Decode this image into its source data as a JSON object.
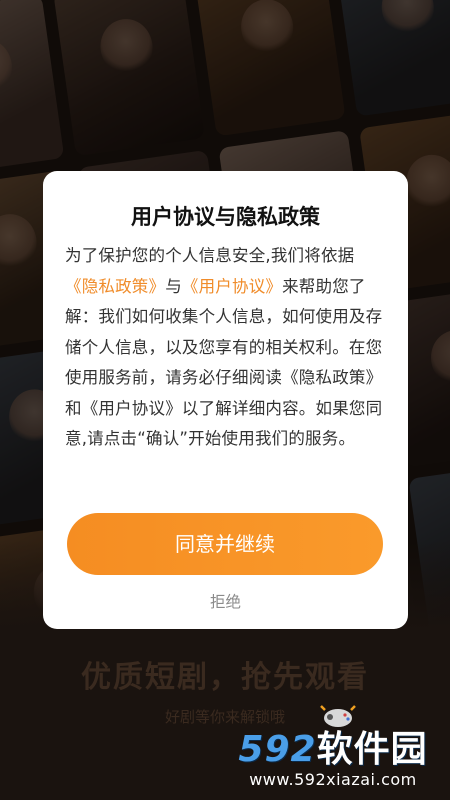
{
  "dialog": {
    "title": "用户协议与隐私政策",
    "body_line1": "为了保护您的个人信息安全,我们将依据",
    "privacy_link": "《隐私政策》",
    "connector": "与",
    "user_agreement_link": "《用户协议》",
    "body_after_links": "来帮助您了解：我们如何收集个人信息，如何使用及存储个人信息，以及您享有的相关权利。在您使用服务前，请务必仔细阅读《隐私政策》和《用户协议》以了解详细内容。如果您同意,请点击“确认”开始使用我们的服务。",
    "agree_label": "同意并继续",
    "reject_label": "拒绝"
  },
  "background": {
    "slogan": "优质短剧，抢先观看",
    "sub_slogan": "好剧等你来解锁哦"
  },
  "watermark": {
    "brand_num": "592",
    "brand_cn": "软件园",
    "url": "www.592xiazai.com"
  },
  "colors": {
    "accent": "#f58d22",
    "link": "#f08c2a",
    "watermark_blue": "#4a9ee8"
  }
}
